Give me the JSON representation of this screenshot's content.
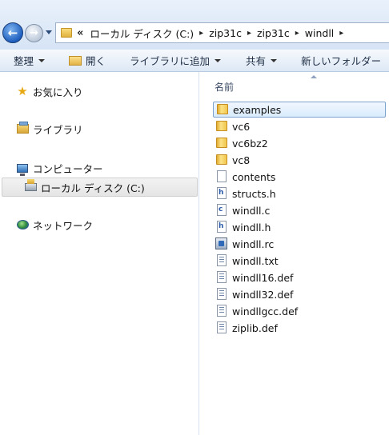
{
  "addressbar": {
    "overflow": "«",
    "crumbs": [
      "ローカル ディスク (C:)",
      "zip31c",
      "zip31c",
      "windll"
    ],
    "separator": "▸"
  },
  "toolbar": {
    "organize": "整理",
    "open": "開く",
    "library": "ライブラリに追加",
    "share": "共有",
    "new_folder": "新しいフォルダー"
  },
  "navpane": {
    "favorites": "お気に入り",
    "libraries": "ライブラリ",
    "computer": "コンピューター",
    "local_disk": "ローカル ディスク (C:)",
    "network": "ネットワーク"
  },
  "filelist": {
    "column_name": "名前",
    "items": [
      {
        "name": "examples",
        "kind": "folder"
      },
      {
        "name": "vc6",
        "kind": "folder"
      },
      {
        "name": "vc6bz2",
        "kind": "folder"
      },
      {
        "name": "vc8",
        "kind": "folder"
      },
      {
        "name": "contents",
        "kind": "file"
      },
      {
        "name": "structs.h",
        "kind": "h"
      },
      {
        "name": "windll.c",
        "kind": "c"
      },
      {
        "name": "windll.h",
        "kind": "h"
      },
      {
        "name": "windll.rc",
        "kind": "rc"
      },
      {
        "name": "windll.txt",
        "kind": "txt"
      },
      {
        "name": "windll16.def",
        "kind": "def"
      },
      {
        "name": "windll32.def",
        "kind": "def"
      },
      {
        "name": "windllgcc.def",
        "kind": "def"
      },
      {
        "name": "ziplib.def",
        "kind": "def"
      }
    ]
  },
  "colors": {
    "selection_border": "#7da2ce",
    "toolbar_text": "#1e2d44",
    "folder_yellow": "#f1c64e"
  },
  "icons": {
    "back": "back-arrow-icon",
    "forward": "forward-arrow-icon",
    "folder": "folder-icon",
    "star": "star-icon"
  }
}
